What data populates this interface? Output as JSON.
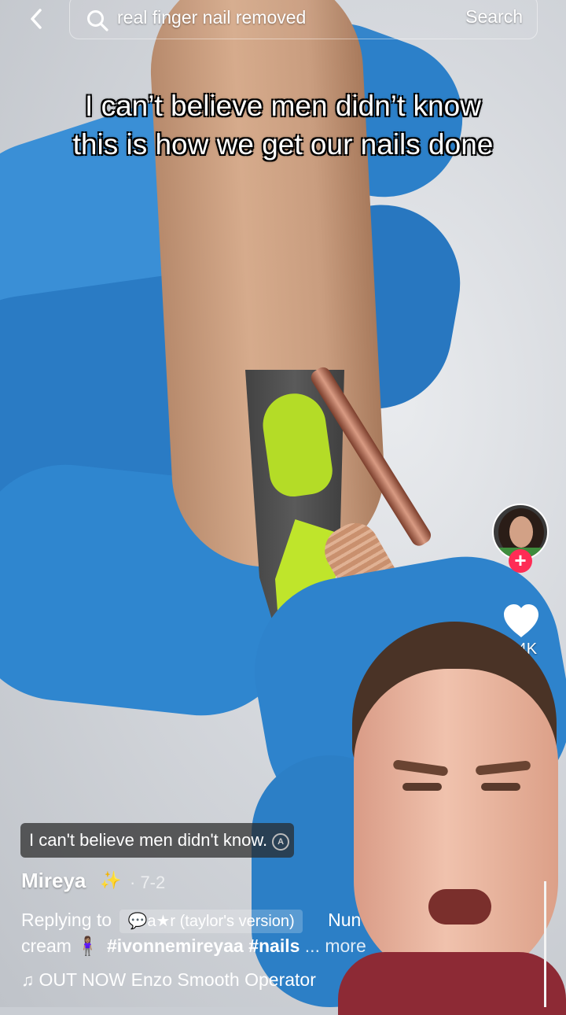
{
  "search": {
    "query": "real finger nail removed",
    "button_label": "Search"
  },
  "video": {
    "caption": "I can’t believe men didn’t know this is how we get our nails done"
  },
  "creator": {
    "username": "Mireya",
    "sparkle": "✨",
    "date": "· 7-2",
    "follow_symbol": "+"
  },
  "engagement": {
    "likes": "3.4K"
  },
  "search_suggestion": {
    "text": "I can't believe men didn't know."
  },
  "description": {
    "replying_prefix": "Replying to",
    "replying_to": "💬a★r (taylor's version)",
    "reply_extra": "Nun",
    "line2_start": "cream 🧍🏽‍♀️",
    "hashtags": "#ivonnemireyaa #nails",
    "more": "... more"
  },
  "music": {
    "note": "♫",
    "title": "OUT NOW Enzo Smooth Operator"
  },
  "colors": {
    "accent": "#fe2c55",
    "glove": "#2f86cf"
  },
  "icons": [
    "back-icon",
    "search-icon",
    "heart-icon",
    "music-note-icon",
    "plus-icon",
    "search-suggestion-icon"
  ]
}
